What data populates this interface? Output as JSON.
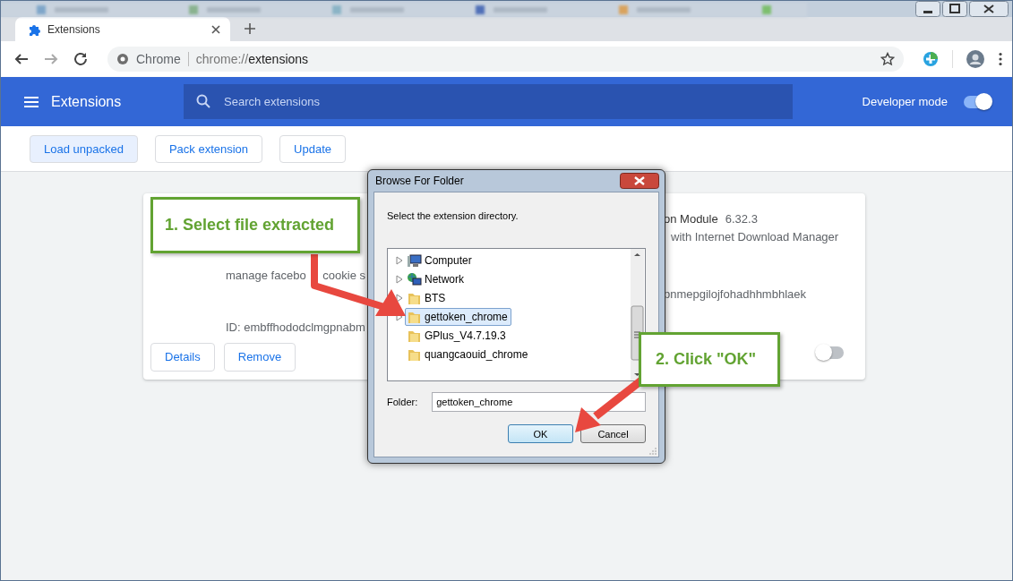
{
  "browser": {
    "tab": {
      "title": "Extensions"
    },
    "address": {
      "scheme_label": "Chrome",
      "url_host": "chrome://",
      "url_path": "extensions"
    }
  },
  "header": {
    "title": "Extensions",
    "search": {
      "placeholder": "Search extensions"
    },
    "developer_mode": {
      "label": "Developer mode",
      "on": true
    }
  },
  "toolbar": {
    "buttons": [
      "Load unpacked",
      "Pack extension",
      "Update"
    ]
  },
  "cards": [
    {
      "description_lines": [
        [
          "manage facebo",
          "cookie s"
        ]
      ],
      "id_part": "ID: embffhododclmgpnabm",
      "buttons": [
        "Details",
        "Remove"
      ]
    },
    {
      "title_part": "on Module",
      "version": "6.32.3",
      "description_lines": [
        [
          "with Internet Download Manager"
        ]
      ],
      "id_part": "pnmepgilojfohadhhmbhlaek",
      "enabled": false
    }
  ],
  "dialog": {
    "title": "Browse For Folder",
    "instruction": "Select the extension directory.",
    "tree": [
      {
        "label": "Computer",
        "kind": "computer",
        "expandable": true,
        "selected": false
      },
      {
        "label": "Network",
        "kind": "network",
        "expandable": true,
        "selected": false
      },
      {
        "label": "BTS",
        "kind": "folder",
        "expandable": true,
        "selected": false
      },
      {
        "label": "gettoken_chrome",
        "kind": "folder",
        "expandable": true,
        "selected": true
      },
      {
        "label": "GPlus_V4.7.19.3",
        "kind": "folder",
        "expandable": false,
        "selected": false
      },
      {
        "label": "quangcaouid_chrome",
        "kind": "folder",
        "expandable": false,
        "selected": false
      }
    ],
    "folder_label": "Folder:",
    "folder_value": "gettoken_chrome",
    "buttons": [
      {
        "label": "OK",
        "default": true
      },
      {
        "label": "Cancel",
        "default": false
      }
    ]
  },
  "callouts": [
    {
      "text": "1. Select file extracted"
    },
    {
      "text": "2. Click \"OK\""
    }
  ]
}
